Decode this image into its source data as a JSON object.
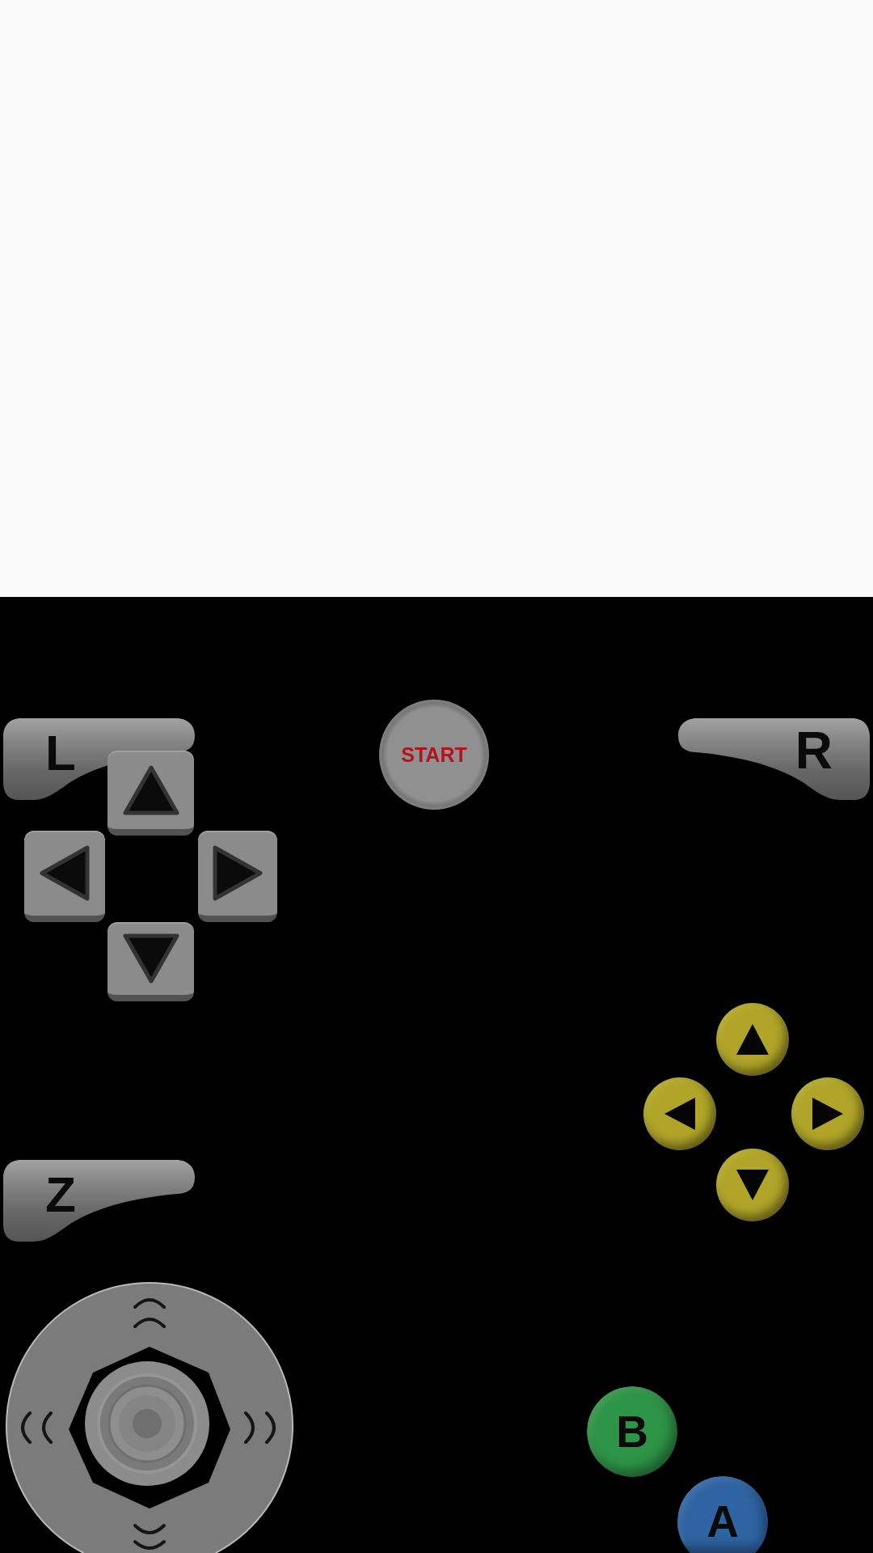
{
  "l_button": {
    "label": "L"
  },
  "start_button": {
    "label": "START"
  },
  "r_button": {
    "label": "R"
  },
  "z_button": {
    "label": "Z"
  },
  "face_buttons": [
    {
      "label": "B",
      "color": "#2e9447"
    },
    {
      "label": "A",
      "color": "#2f64a2"
    }
  ]
}
